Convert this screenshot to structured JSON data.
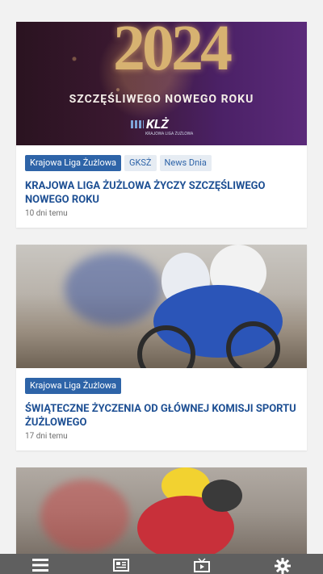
{
  "articles": [
    {
      "tags": [
        "Krajowa Liga Żużlowa",
        "GKSŻ",
        "News Dnia"
      ],
      "title": "KRAJOWA LIGA ŻUŻLOWA ŻYCZY SZCZĘŚLIWEGO NOWEGO ROKU",
      "age": "10 dni temu",
      "image": {
        "year_text": "2024",
        "greeting": "SZCZĘŚLIWEGO NOWEGO ROKU",
        "logo_text": "KLŻ",
        "logo_sub": "KRAJOWA LIGA ŻUŻLOWA"
      }
    },
    {
      "tags": [
        "Krajowa Liga Żużlowa"
      ],
      "title": "ŚWIĄTECZNE ŻYCZENIA OD GŁÓWNEJ KOMISJI SPORTU ŻUŻLOWEGO",
      "age": "17 dni temu"
    },
    {
      "tags": [],
      "title": "",
      "age": ""
    }
  ],
  "bottom_nav": [
    {
      "icon": "menu-icon"
    },
    {
      "icon": "news-icon"
    },
    {
      "icon": "tv-icon"
    },
    {
      "icon": "settings-icon"
    }
  ],
  "colors": {
    "accent": "#2e64a8",
    "title": "#1d4f93",
    "tag_secondary_bg": "#e6ecf3",
    "bottom_bar": "#5f5f5f"
  }
}
